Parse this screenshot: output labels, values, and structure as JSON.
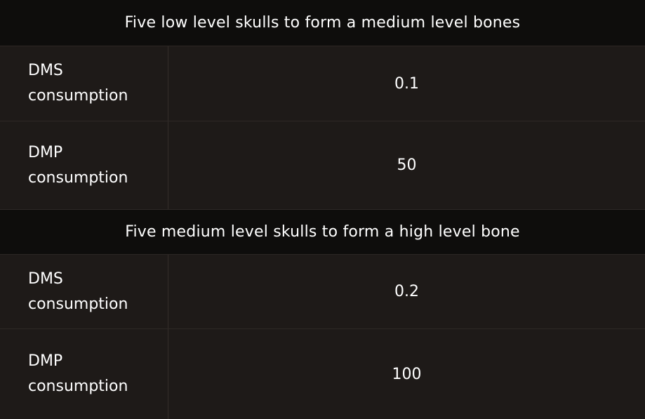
{
  "sections": [
    {
      "title": "Five low level skulls to form a medium level bones",
      "rows": [
        {
          "label": "DMS\nconsumption",
          "value": "0.1"
        },
        {
          "label": "DMP\nconsumption",
          "value": "50"
        }
      ]
    },
    {
      "title": "Five medium level skulls to form a high level bone",
      "rows": [
        {
          "label": "DMS\nconsumption",
          "value": "0.2"
        },
        {
          "label": "DMP\nconsumption",
          "value": "100"
        }
      ]
    }
  ],
  "colors": {
    "header_background": "#0e0d0c",
    "row_background": "#1e1a18",
    "text": "#ffffff",
    "divider": "#342e2a"
  }
}
